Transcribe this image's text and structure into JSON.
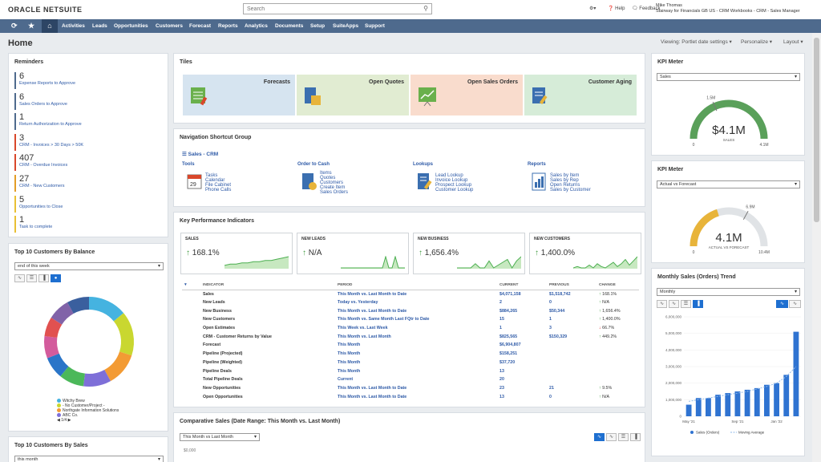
{
  "header": {
    "logo": "ORACLE NETSUITE",
    "search_placeholder": "Search",
    "help": "Help",
    "feedback": "Feedback",
    "user_name": "Mike Thomas",
    "user_role": "Stairway for Financials GB US - CRM Workbooks - CRM - Sales Manager"
  },
  "nav": [
    "Activities",
    "Leads",
    "Opportunities",
    "Customers",
    "Forecast",
    "Reports",
    "Analytics",
    "Documents",
    "Setup",
    "SuiteApps",
    "Support"
  ],
  "page": {
    "title": "Home",
    "viewing": "Viewing: Portlet date settings",
    "personalize": "Personalize",
    "layout": "Layout"
  },
  "reminders": {
    "title": "Reminders",
    "items": [
      {
        "num": "6",
        "label": "Expense Reports to Approve",
        "color": "#4e6a8d"
      },
      {
        "num": "6",
        "label": "Sales Orders to Approve",
        "color": "#4e6a8d"
      },
      {
        "num": "1",
        "label": "Return Authorization to Approve",
        "color": "#4e6a8d"
      },
      {
        "num": "3",
        "label": "CRM - Invoices > 30 Days > 50K",
        "color": "#d9472b"
      },
      {
        "num": "407",
        "label": "CRM - Overdue Invoices",
        "color": "#d9472b"
      },
      {
        "num": "27",
        "label": "CRM - New Customers",
        "color": "#e39d26"
      },
      {
        "num": "5",
        "label": "Opportunities to Close",
        "color": "#e9c034"
      },
      {
        "num": "1",
        "label": "Task to complete",
        "color": "#e9c034"
      }
    ]
  },
  "top_balance": {
    "title": "Top 10 Customers By Balance",
    "select": "end of this week",
    "legend": [
      "Witchy Brew",
      "- No Customer/Project -",
      "Northgate Information Solutions",
      "ABC Co."
    ],
    "pager": "1/4",
    "donut": [
      {
        "value": 14,
        "color": "#45b3e0"
      },
      {
        "value": 16,
        "color": "#c9d730"
      },
      {
        "value": 12,
        "color": "#f39b34"
      },
      {
        "value": 10,
        "color": "#7e6fd8"
      },
      {
        "value": 9,
        "color": "#4bb85a"
      },
      {
        "value": 8,
        "color": "#2a75c8"
      },
      {
        "value": 8,
        "color": "#d35b9c"
      },
      {
        "value": 7,
        "color": "#e15150"
      },
      {
        "value": 8,
        "color": "#8163a8"
      },
      {
        "value": 8,
        "color": "#3a5f9e"
      }
    ]
  },
  "top_sales": {
    "title": "Top 10 Customers By Sales",
    "select": "this month"
  },
  "tiles": {
    "title": "Tiles",
    "items": [
      {
        "label": "Forecasts",
        "bg": "#d6e4f0"
      },
      {
        "label": "Open Quotes",
        "bg": "#e1ecd2"
      },
      {
        "label": "Open Sales Orders",
        "bg": "#f9dccd"
      },
      {
        "label": "Customer Aging",
        "bg": "#d6ecd8"
      }
    ]
  },
  "nsg": {
    "title": "Navigation Shortcut Group",
    "group": "Sales - CRM",
    "sections": [
      {
        "head": "Tools",
        "links": [
          "Tasks",
          "Calendar",
          "File Cabinet",
          "Phone Calls"
        ]
      },
      {
        "head": "Order to Cash",
        "links": [
          "Items",
          "Quotes",
          "Customers",
          "Create Item",
          "Sales Orders"
        ]
      },
      {
        "head": "Lookups",
        "links": [
          "Lead Lookup",
          "Invoice Lookup",
          "Prospect Lookup",
          "Customer Lookup"
        ]
      },
      {
        "head": "Reports",
        "links": [
          "Sales by Item",
          "Sales by Rep",
          "Open Returns",
          "Sales by Customer"
        ]
      }
    ]
  },
  "kpi": {
    "title": "Key Performance Indicators",
    "cards": [
      {
        "title": "SALES",
        "value": "168.1%",
        "spark": [
          2,
          3,
          3,
          4,
          4,
          5,
          5,
          6,
          6,
          7,
          8,
          9
        ]
      },
      {
        "title": "NEW LEADS",
        "value": "N/A",
        "spark": [
          0,
          0,
          0,
          0,
          0,
          0,
          0,
          0,
          0,
          0,
          0,
          0,
          0,
          0,
          6,
          0,
          0,
          6,
          0,
          0,
          0
        ]
      },
      {
        "title": "NEW BUSINESS",
        "value": "1,656.4%",
        "spark": [
          0,
          0,
          0,
          0,
          3,
          0,
          0,
          5,
          0,
          2,
          4,
          6,
          0,
          5,
          8
        ]
      },
      {
        "title": "NEW CUSTOMERS",
        "value": "1,400.0%",
        "spark": [
          0,
          1,
          0,
          0,
          2,
          0,
          3,
          1,
          0,
          2,
          4,
          1,
          3,
          6,
          2,
          5,
          8
        ]
      }
    ],
    "headers": [
      "INDICATOR",
      "PERIOD",
      "CURRENT",
      "PREVIOUS",
      "CHANGE"
    ],
    "rows": [
      {
        "name": "Sales",
        "period": "This Month vs. Last Month to Date",
        "current": "$4,071,158",
        "previous": "$1,518,742",
        "change": "168.1%",
        "dir": "up"
      },
      {
        "name": "New Leads",
        "period": "Today vs. Yesterday",
        "current": "2",
        "previous": "0",
        "change": "N/A",
        "dir": "up"
      },
      {
        "name": "New Business",
        "period": "This Month vs. Last Month to Date",
        "current": "$884,265",
        "previous": "$50,344",
        "change": "1,656.4%",
        "dir": "up"
      },
      {
        "name": "New Customers",
        "period": "This Month vs. Same Month Last FQtr to Date",
        "current": "15",
        "previous": "1",
        "change": "1,400.0%",
        "dir": "up"
      },
      {
        "name": "Open Estimates",
        "period": "This Week vs. Last Week",
        "current": "1",
        "previous": "3",
        "change": "66.7%",
        "dir": "down"
      },
      {
        "name": "CRM - Customer Returns by Value",
        "period": "This Month vs. Last Month",
        "current": "$825,565",
        "previous": "$150,329",
        "change": "449.2%",
        "dir": "up"
      },
      {
        "name": "Forecast",
        "period": "This Month",
        "current": "$6,904,807",
        "previous": "",
        "change": "",
        "dir": ""
      },
      {
        "name": "Pipeline (Projected)",
        "period": "This Month",
        "current": "$158,251",
        "previous": "",
        "change": "",
        "dir": ""
      },
      {
        "name": "Pipeline (Weighted)",
        "period": "This Month",
        "current": "$37,720",
        "previous": "",
        "change": "",
        "dir": ""
      },
      {
        "name": "Pipeline Deals",
        "period": "This Month",
        "current": "13",
        "previous": "",
        "change": "",
        "dir": ""
      },
      {
        "name": "Total Pipeline Deals",
        "period": "Current",
        "current": "20",
        "previous": "",
        "change": "",
        "dir": ""
      },
      {
        "name": "New Opportunities",
        "period": "This Month vs. Last Month to Date",
        "current": "23",
        "previous": "21",
        "change": "9.5%",
        "dir": "up"
      },
      {
        "name": "Open Opportunities",
        "period": "This Month vs. Last Month to Date",
        "current": "13",
        "previous": "0",
        "change": "N/A",
        "dir": "up"
      }
    ]
  },
  "comparative": {
    "title": "Comparative Sales (Date Range: This Month vs. Last Month)",
    "select": "This Month vs Last Month",
    "ytick": "$0,000"
  },
  "kpi_meter1": {
    "title": "KPI Meter",
    "select": "Sales",
    "value": "$4.1M",
    "sub": "SALES",
    "min": "0",
    "max": "4.1M",
    "target": "1.5M",
    "fraction": 1.0,
    "target_fraction": 0.37,
    "color": "#5aa05a"
  },
  "kpi_meter2": {
    "title": "KPI Meter",
    "select": "Actual vs Forecast",
    "value": "4.1M",
    "sub": "ACTUAL VS FORECAST",
    "min": "0",
    "max": "10.4M",
    "target": "6.9M",
    "fraction": 0.4,
    "target_fraction": 0.66,
    "color": "#e8b43a"
  },
  "monthly": {
    "title": "Monthly Sales (Orders) Trend",
    "select": "Monthly",
    "legend_sales": "Sales (Orders)",
    "legend_avg": "Moving Average"
  },
  "chart_data": {
    "type": "bar",
    "title": "Monthly Sales (Orders) Trend",
    "categories": [
      "May '21",
      "",
      "",
      "",
      "",
      "Sep '21",
      "",
      "",
      "",
      "Jan '22",
      "",
      ""
    ],
    "series": [
      {
        "name": "Sales (Orders)",
        "values": [
          700000,
          1100000,
          1100000,
          1300000,
          1400000,
          1500000,
          1600000,
          1700000,
          1900000,
          2000000,
          2500000,
          5100000
        ]
      },
      {
        "name": "Moving Average",
        "values": [
          900000,
          1000000,
          1100000,
          1200000,
          1300000,
          1400000,
          1500000,
          1650000,
          1800000,
          2000000,
          2400000,
          3000000
        ]
      }
    ],
    "yticks": [
      "0",
      "1,000,000",
      "2,000,000",
      "3,000,000",
      "4,000,000",
      "5,000,000",
      "6,000,000"
    ],
    "ylim": [
      0,
      6000000
    ],
    "xticks": [
      "May '21",
      "Sep '21",
      "Jan '22"
    ]
  }
}
